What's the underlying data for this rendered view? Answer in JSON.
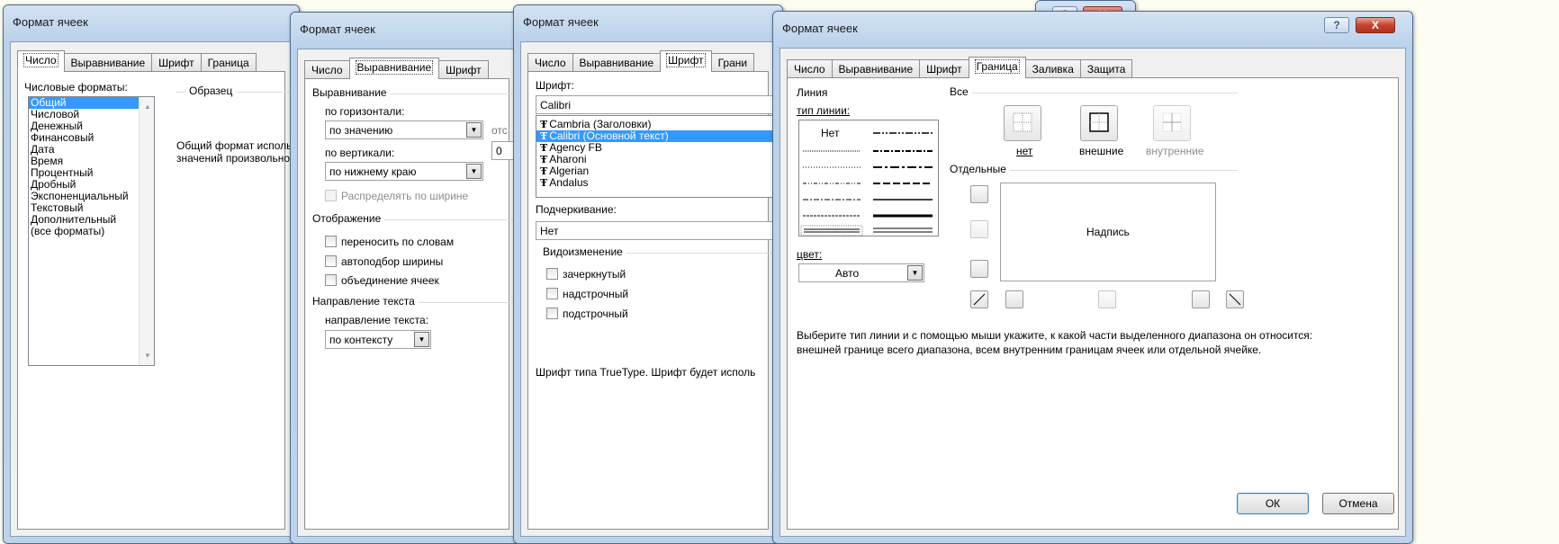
{
  "colors": {
    "selection": "#3399ff",
    "frame": "#b9d1ea",
    "close_button": "#c4432f"
  },
  "icons": [
    "help-icon",
    "close-icon",
    "dropdown-arrow-icon",
    "font-type-icon",
    "border-preset-icon",
    "scroll-arrow-icon"
  ],
  "win1": {
    "title": "Формат ячеек",
    "tabs": [
      "Число",
      "Выравнивание",
      "Шрифт",
      "Граница"
    ],
    "formats_label": "Числовые форматы:",
    "formats": [
      "Общий",
      "Числовой",
      "Денежный",
      "Финансовый",
      "Дата",
      "Время",
      "Процентный",
      "Дробный",
      "Экспоненциальный",
      "Текстовый",
      "Дополнительный",
      "(все форматы)"
    ],
    "sample_label": "Образец",
    "desc_line1": "Общий формат исполь",
    "desc_line2": "значений произвольно"
  },
  "win2": {
    "title": "Формат ячеек",
    "tabs": [
      "Число",
      "Выравнивание",
      "Шрифт"
    ],
    "alignment_group": "Выравнивание",
    "horiz_label": "по горизонтали:",
    "horiz_value": "по значению",
    "offset_label": "отс",
    "offset_value": "0",
    "vert_label": "по вертикали:",
    "vert_value": "по нижнему краю",
    "distribute": "Распределять по ширине",
    "display_group": "Отображение",
    "wrap": "переносить по словам",
    "autofit": "автоподбор ширины",
    "merge": "объединение ячеек",
    "direction_group": "Направление текста",
    "direction_label": "направление текста:",
    "direction_value": "по контексту"
  },
  "win3": {
    "title": "Формат ячеек",
    "tabs": [
      "Число",
      "Выравнивание",
      "Шрифт",
      "Грани"
    ],
    "font_label": "Шрифт:",
    "font_value": "Calibri",
    "fonts": [
      "Cambria (Заголовки)",
      "Calibri (Основной текст)",
      "Agency FB",
      "Aharoni",
      "Algerian",
      "Andalus"
    ],
    "underline_label": "Подчеркивание:",
    "underline_value": "Нет",
    "effects_group": "Видоизменение",
    "strike": "зачеркнутый",
    "superscript": "надстрочный",
    "subscript": "подстрочный",
    "note": "Шрифт типа TrueType. Шрифт будет исполь"
  },
  "win4": {
    "title": "Формат ячеек",
    "help": "?",
    "close": "X",
    "tabs": [
      "Число",
      "Выравнивание",
      "Шрифт",
      "Граница",
      "Заливка",
      "Защита"
    ],
    "line_group": "Линия",
    "line_type_label": "тип линии:",
    "line_none": "Нет",
    "color_label": "цвет:",
    "color_value": "Авто",
    "all_group": "Все",
    "preset_none": "нет",
    "preset_outer": "внешние",
    "preset_inner": "внутренние",
    "separate_group": "Отдельные",
    "preview_text": "Надпись",
    "help_line1": "Выберите тип линии и с помощью мыши укажите, к какой части выделенного диапазона он относится:",
    "help_line2": "внешней границе всего диапазона, всем внутренним границам ячеек или отдельной ячейке.",
    "ok": "ОК",
    "cancel": "Отмена"
  },
  "back": {
    "help": "?",
    "close": "X"
  }
}
